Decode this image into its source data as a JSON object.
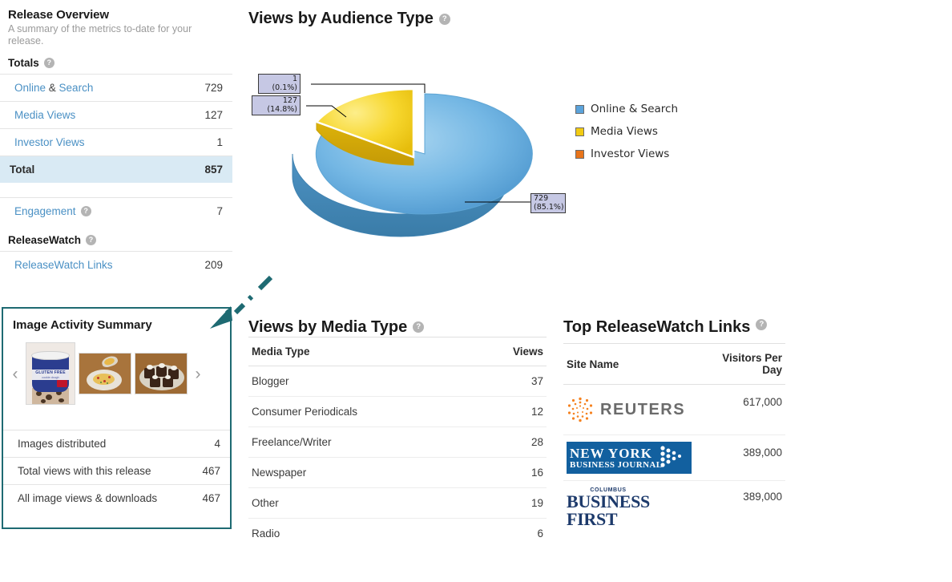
{
  "overview": {
    "title": "Release Overview",
    "subtitle": "A summary of the metrics to-date for your release.",
    "totals_heading": "Totals",
    "help_glyph": "?",
    "rows": [
      {
        "label_a": "Online",
        "amp": " & ",
        "label_b": "Search",
        "value": "729"
      },
      {
        "label": "Media Views",
        "value": "127"
      },
      {
        "label": "Investor Views",
        "value": "1"
      },
      {
        "label": "Total",
        "value": "857"
      }
    ],
    "engagement": {
      "label": "Engagement",
      "value": "7"
    },
    "releasewatch_heading": "ReleaseWatch",
    "releasewatch_links": {
      "label": "ReleaseWatch Links",
      "value": "209"
    }
  },
  "image_activity": {
    "title": "Image Activity Summary",
    "prev_arrow": "‹",
    "next_arrow": "›",
    "thumb_labels": [
      "gluten-free-cookie-dough-tub",
      "plated-food-dish",
      "brownie-bites-platter"
    ],
    "rows": [
      {
        "label": "Images distributed",
        "value": "4"
      },
      {
        "label": "Total views with this release",
        "value": "467"
      },
      {
        "label": "All image views & downloads",
        "value": "467"
      }
    ]
  },
  "audience_chart": {
    "title": "Views by Audience Type",
    "callouts": [
      {
        "value": "1",
        "pct": "(0.1%)"
      },
      {
        "value": "127",
        "pct": "(14.8%)"
      },
      {
        "value": "729",
        "pct": "(85.1%)"
      }
    ],
    "legend": [
      {
        "label": "Online & Search",
        "color": "#5ba3db"
      },
      {
        "label": "Media Views",
        "color": "#f2cb12"
      },
      {
        "label": "Investor Views",
        "color": "#e8741a"
      }
    ]
  },
  "chart_data": {
    "type": "pie",
    "title": "Views by Audience Type",
    "categories": [
      "Online & Search",
      "Media Views",
      "Investor Views"
    ],
    "values": [
      729,
      127,
      1
    ],
    "percentages": [
      85.1,
      14.8,
      0.1
    ],
    "colors": [
      "#5ba3db",
      "#f2cb12",
      "#e8741a"
    ],
    "total": 857,
    "legend_position": "right",
    "exploded_slice": "Media Views",
    "three_d": true,
    "labels": [
      "729\n(85.1%)",
      "127\n(14.8%)",
      "1\n(0.1%)"
    ]
  },
  "media_table": {
    "title": "Views by Media Type",
    "columns": [
      "Media Type",
      "Views"
    ],
    "rows": [
      {
        "type": "Blogger",
        "views": "37"
      },
      {
        "type": "Consumer Periodicals",
        "views": "12"
      },
      {
        "type": "Freelance/Writer",
        "views": "28"
      },
      {
        "type": "Newspaper",
        "views": "16"
      },
      {
        "type": "Other",
        "views": "19"
      },
      {
        "type": "Radio",
        "views": "6"
      }
    ]
  },
  "releasewatch_table": {
    "title": "Top ReleaseWatch Links",
    "columns": [
      "Site Name",
      "Visitors Per Day"
    ],
    "rows": [
      {
        "site": "REUTERS",
        "logo": "reuters-logo",
        "visitors": "617,000"
      },
      {
        "site": "NEW YORK BUSINESS JOURNAL",
        "logo": "new-york-business-journal-logo",
        "visitors": "389,000"
      },
      {
        "site": "COLUMBUS BUSINESS FIRST",
        "logo": "columbus-business-first-logo",
        "visitors": "389,000"
      }
    ],
    "ny_logo": {
      "line1": "NEW YORK",
      "line2": "BUSINESS JOURNAL"
    },
    "bf_logo": {
      "top": "COLUMBUS",
      "main": "BUSINESS FIRST"
    }
  },
  "colors": {
    "accent_link": "#4a90c4",
    "total_row_bg": "#d9eaf4",
    "highlight_border": "#1e6a72",
    "pie_blue": "#5ba3db",
    "pie_yellow": "#f2cb12",
    "pie_orange": "#e8741a"
  }
}
